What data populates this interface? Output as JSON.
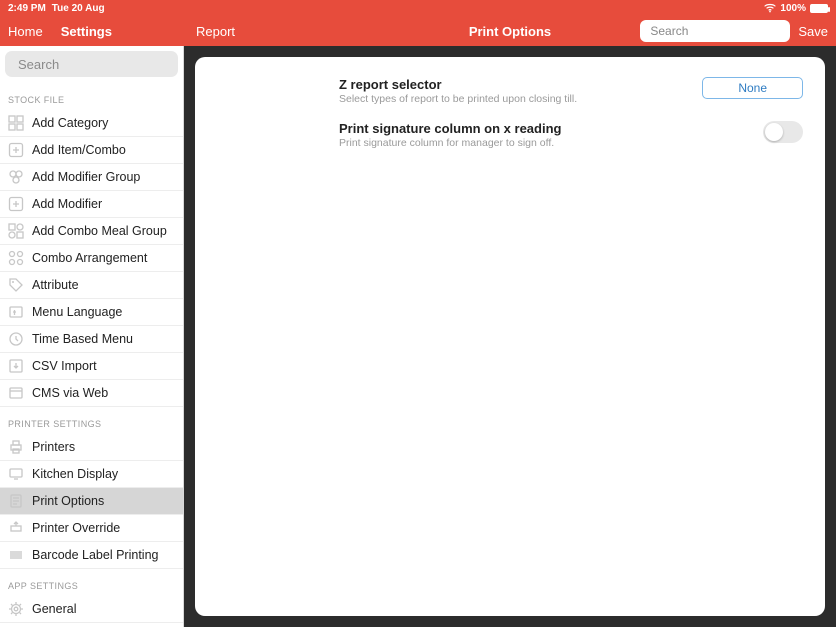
{
  "status": {
    "time": "2:49 PM",
    "date": "Tue 20 Aug",
    "battery": "100%"
  },
  "header": {
    "home": "Home",
    "settings": "Settings",
    "report": "Report",
    "title": "Print Options",
    "search_placeholder": "Search",
    "save": "Save"
  },
  "sidebar": {
    "search_placeholder": "Search",
    "sections": [
      {
        "header": "STOCK FILE",
        "items": [
          {
            "label": "Add Category",
            "icon": "category-icon"
          },
          {
            "label": "Add Item/Combo",
            "icon": "plus-box-icon"
          },
          {
            "label": "Add Modifier Group",
            "icon": "modifier-group-icon"
          },
          {
            "label": "Add Modifier",
            "icon": "plus-box-icon"
          },
          {
            "label": "Add Combo Meal Group",
            "icon": "combo-group-icon"
          },
          {
            "label": "Combo Arrangement",
            "icon": "arrangement-icon"
          },
          {
            "label": "Attribute",
            "icon": "tag-icon"
          },
          {
            "label": "Menu Language",
            "icon": "language-icon"
          },
          {
            "label": "Time Based Menu",
            "icon": "clock-icon"
          },
          {
            "label": "CSV Import",
            "icon": "import-icon"
          },
          {
            "label": "CMS via Web",
            "icon": "web-icon"
          }
        ]
      },
      {
        "header": "PRINTER SETTINGS",
        "items": [
          {
            "label": "Printers",
            "icon": "printer-icon"
          },
          {
            "label": "Kitchen Display",
            "icon": "display-icon"
          },
          {
            "label": "Print Options",
            "icon": "print-options-icon",
            "selected": true
          },
          {
            "label": "Printer Override",
            "icon": "override-icon"
          },
          {
            "label": "Barcode Label Printing",
            "icon": "barcode-icon"
          }
        ]
      },
      {
        "header": "APP SETTINGS",
        "items": [
          {
            "label": "General",
            "icon": "gear-icon"
          }
        ]
      }
    ]
  },
  "main": {
    "rows": [
      {
        "title": "Z report selector",
        "sub": "Select types of report to be printed upon closing till.",
        "control": "button",
        "button_label": "None"
      },
      {
        "title": "Print signature column on x reading",
        "sub": "Print signature column for manager to sign off.",
        "control": "toggle",
        "toggle_on": false
      }
    ]
  }
}
